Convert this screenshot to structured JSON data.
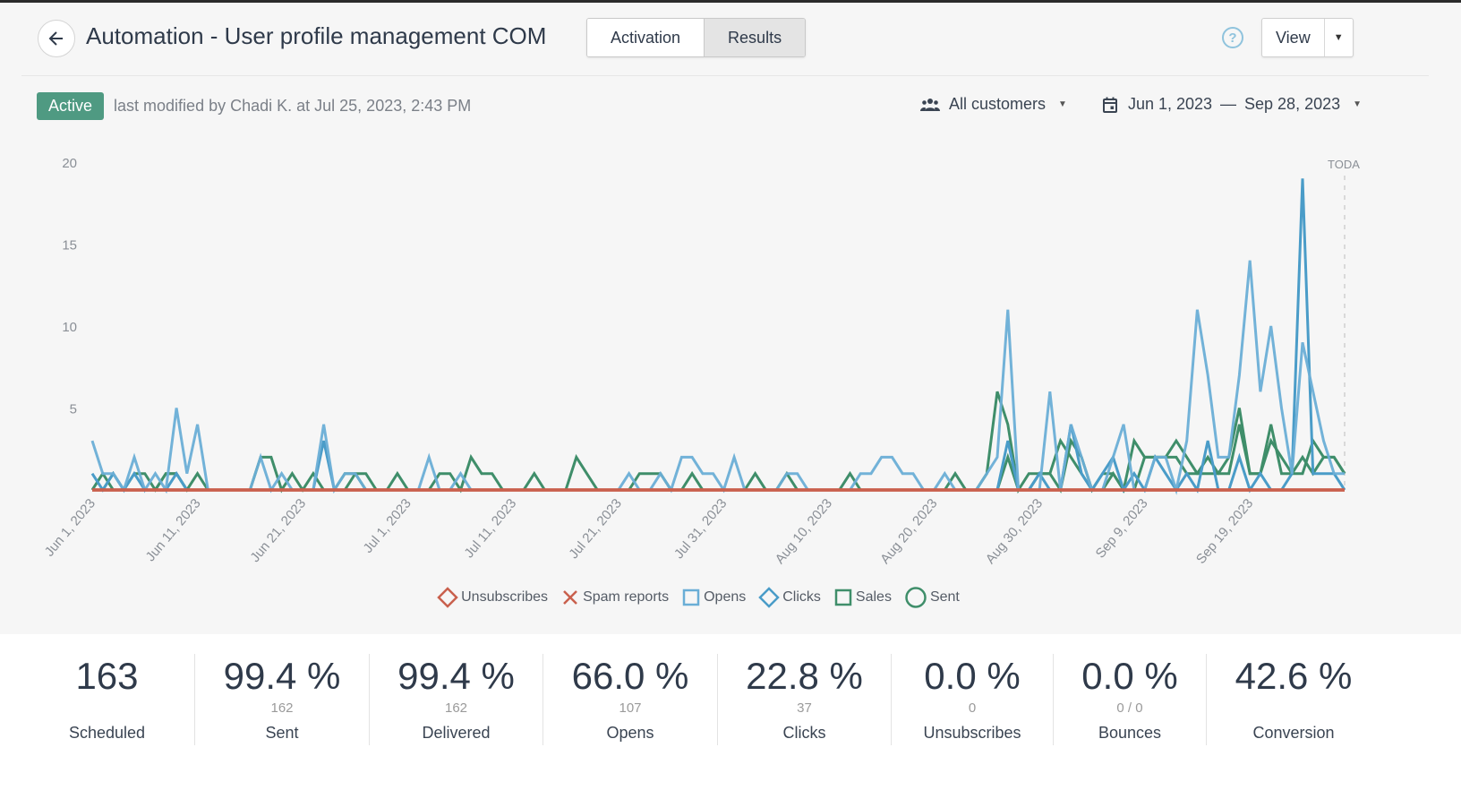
{
  "header": {
    "title": "Automation - User profile management COM",
    "tabs": [
      {
        "label": "Activation",
        "active": false
      },
      {
        "label": "Results",
        "active": true
      }
    ],
    "help_icon": "question-circle-icon",
    "view_label": "View"
  },
  "status": {
    "badge": "Active",
    "badge_color": "#4f9a82",
    "modified_text": "last modified by Chadi K. at Jul 25, 2023, 2:43 PM"
  },
  "filters": {
    "audience": "All customers",
    "date_start": "Jun 1, 2023",
    "date_sep": "—",
    "date_end": "Sep 28, 2023"
  },
  "chart_data": {
    "type": "line",
    "title": "",
    "xlabel": "",
    "ylabel": "",
    "ylim": [
      0,
      20
    ],
    "yticks": [
      "5",
      "10",
      "15",
      "20"
    ],
    "x_start": "Jun 1, 2023",
    "x_end": "Sep 28, 2023",
    "x_days": 120,
    "xtick_labels": [
      "Jun 1, 2023",
      "Jun 11, 2023",
      "Jun 21, 2023",
      "Jul 1, 2023",
      "Jul 11, 2023",
      "Jul 21, 2023",
      "Jul 31, 2023",
      "Aug 10, 2023",
      "Aug 20, 2023",
      "Aug 30, 2023",
      "Sep 9, 2023",
      "Sep 19, 2023"
    ],
    "today_label": "TODA",
    "grid": false,
    "legend_position": "bottom",
    "series": [
      {
        "name": "Unsubscribes",
        "color": "#c9604d",
        "marker": "diamond",
        "values": [
          0,
          0,
          0,
          0,
          0,
          0,
          0,
          0,
          0,
          0,
          0,
          0,
          0,
          0,
          0,
          0,
          0,
          0,
          0,
          0,
          0,
          0,
          0,
          0,
          0,
          0,
          0,
          0,
          0,
          0,
          0,
          0,
          0,
          0,
          0,
          0,
          0,
          0,
          0,
          0,
          0,
          0,
          0,
          0,
          0,
          0,
          0,
          0,
          0,
          0,
          0,
          0,
          0,
          0,
          0,
          0,
          0,
          0,
          0,
          0,
          0,
          0,
          0,
          0,
          0,
          0,
          0,
          0,
          0,
          0,
          0,
          0,
          0,
          0,
          0,
          0,
          0,
          0,
          0,
          0,
          0,
          0,
          0,
          0,
          0,
          0,
          0,
          0,
          0,
          0,
          0,
          0,
          0,
          0,
          0,
          0,
          0,
          0,
          0,
          0,
          0,
          0,
          0,
          0,
          0,
          0,
          0,
          0,
          0,
          0,
          0,
          0,
          0,
          0,
          0,
          0,
          0,
          0,
          0,
          0
        ]
      },
      {
        "name": "Spam reports",
        "color": "#c9604d",
        "marker": "x",
        "values": [
          0,
          0,
          0,
          0,
          0,
          0,
          0,
          0,
          0,
          0,
          0,
          0,
          0,
          0,
          0,
          0,
          0,
          0,
          0,
          0,
          0,
          0,
          0,
          0,
          0,
          0,
          0,
          0,
          0,
          0,
          0,
          0,
          0,
          0,
          0,
          0,
          0,
          0,
          0,
          0,
          0,
          0,
          0,
          0,
          0,
          0,
          0,
          0,
          0,
          0,
          0,
          0,
          0,
          0,
          0,
          0,
          0,
          0,
          0,
          0,
          0,
          0,
          0,
          0,
          0,
          0,
          0,
          0,
          0,
          0,
          0,
          0,
          0,
          0,
          0,
          0,
          0,
          0,
          0,
          0,
          0,
          0,
          0,
          0,
          0,
          0,
          0,
          0,
          0,
          0,
          0,
          0,
          0,
          0,
          0,
          0,
          0,
          0,
          0,
          0,
          0,
          0,
          0,
          0,
          0,
          0,
          0,
          0,
          0,
          0,
          0,
          0,
          0,
          0,
          0,
          0,
          0,
          0,
          0,
          0
        ]
      },
      {
        "name": "Opens",
        "color": "#6aaed6",
        "marker": "square",
        "values": [
          3,
          1,
          1,
          0,
          2,
          0,
          1,
          0,
          5,
          1,
          4,
          0,
          0,
          0,
          0,
          0,
          2,
          0,
          1,
          0,
          0,
          0,
          4,
          0,
          1,
          1,
          0,
          0,
          0,
          0,
          0,
          0,
          2,
          0,
          0,
          1,
          0,
          0,
          0,
          0,
          0,
          0,
          0,
          0,
          0,
          0,
          0,
          0,
          0,
          0,
          0,
          1,
          0,
          0,
          1,
          0,
          2,
          2,
          1,
          1,
          0,
          2,
          0,
          0,
          0,
          0,
          1,
          1,
          0,
          0,
          0,
          0,
          0,
          1,
          1,
          2,
          2,
          1,
          1,
          0,
          0,
          1,
          0,
          0,
          0,
          1,
          2,
          11,
          0,
          0,
          0,
          6,
          0,
          4,
          2,
          0,
          0,
          2,
          4,
          0,
          0,
          2,
          2,
          0,
          3,
          11,
          7,
          2,
          2,
          7,
          14,
          6,
          10,
          5,
          1,
          9,
          6,
          3,
          1,
          1
        ]
      },
      {
        "name": "Clicks",
        "color": "#4a9cc8",
        "marker": "diamond",
        "values": [
          1,
          0,
          1,
          0,
          1,
          0,
          0,
          0,
          1,
          0,
          0,
          0,
          0,
          0,
          0,
          0,
          0,
          0,
          0,
          0,
          0,
          0,
          3,
          0,
          0,
          0,
          0,
          0,
          0,
          0,
          0,
          0,
          0,
          0,
          0,
          0,
          0,
          0,
          0,
          0,
          0,
          0,
          0,
          0,
          0,
          0,
          0,
          0,
          0,
          0,
          0,
          0,
          0,
          0,
          0,
          0,
          0,
          0,
          0,
          0,
          0,
          0,
          0,
          0,
          0,
          0,
          0,
          0,
          0,
          0,
          0,
          0,
          0,
          0,
          0,
          0,
          0,
          0,
          0,
          0,
          0,
          0,
          0,
          0,
          0,
          0,
          0,
          3,
          0,
          0,
          1,
          0,
          0,
          4,
          1,
          0,
          1,
          2,
          0,
          1,
          0,
          2,
          1,
          0,
          1,
          0,
          3,
          0,
          0,
          2,
          0,
          1,
          0,
          0,
          1,
          19,
          1,
          1,
          1,
          0
        ]
      },
      {
        "name": "Sales",
        "color": "#3f8e6a",
        "marker": "square",
        "values": [
          0,
          1,
          0,
          0,
          1,
          1,
          0,
          1,
          1,
          0,
          1,
          0,
          0,
          0,
          0,
          0,
          2,
          2,
          0,
          1,
          0,
          1,
          0,
          0,
          0,
          1,
          1,
          0,
          0,
          1,
          0,
          0,
          0,
          1,
          1,
          0,
          2,
          1,
          1,
          0,
          0,
          0,
          1,
          0,
          0,
          0,
          2,
          1,
          0,
          0,
          0,
          0,
          1,
          1,
          1,
          0,
          0,
          1,
          0,
          0,
          0,
          0,
          0,
          1,
          0,
          0,
          1,
          0,
          0,
          0,
          0,
          0,
          1,
          0,
          0,
          0,
          0,
          0,
          0,
          0,
          0,
          0,
          1,
          0,
          0,
          1,
          6,
          4,
          0,
          1,
          1,
          1,
          0,
          3,
          2,
          0,
          1,
          1,
          0,
          3,
          2,
          2,
          2,
          3,
          2,
          1,
          1,
          1,
          2,
          5,
          1,
          1,
          3,
          2,
          1,
          1,
          3,
          2,
          2,
          1
        ]
      },
      {
        "name": "Sent",
        "color": "#3f8e6a",
        "marker": "circle",
        "values": [
          0,
          0,
          1,
          0,
          0,
          0,
          0,
          1,
          1,
          0,
          0,
          0,
          0,
          0,
          0,
          0,
          0,
          0,
          0,
          0,
          0,
          0,
          0,
          0,
          1,
          1,
          0,
          0,
          0,
          0,
          0,
          0,
          0,
          0,
          0,
          0,
          0,
          0,
          0,
          0,
          0,
          0,
          0,
          0,
          0,
          0,
          0,
          0,
          0,
          0,
          0,
          0,
          0,
          0,
          0,
          0,
          0,
          0,
          0,
          0,
          0,
          0,
          0,
          0,
          0,
          0,
          0,
          0,
          0,
          0,
          0,
          0,
          0,
          0,
          0,
          0,
          0,
          0,
          0,
          0,
          0,
          0,
          0,
          0,
          0,
          0,
          0,
          2,
          0,
          0,
          1,
          1,
          3,
          2,
          1,
          0,
          0,
          1,
          0,
          0,
          2,
          2,
          2,
          2,
          1,
          1,
          2,
          1,
          1,
          4,
          1,
          1,
          4,
          1,
          1,
          2,
          1,
          2,
          2,
          1
        ]
      }
    ]
  },
  "stats": [
    {
      "value": "163",
      "sub": "",
      "label": "Scheduled"
    },
    {
      "value": "99.4 %",
      "sub": "162",
      "label": "Sent"
    },
    {
      "value": "99.4 %",
      "sub": "162",
      "label": "Delivered"
    },
    {
      "value": "66.0 %",
      "sub": "107",
      "label": "Opens"
    },
    {
      "value": "22.8 %",
      "sub": "37",
      "label": "Clicks"
    },
    {
      "value": "0.0 %",
      "sub": "0",
      "label": "Unsubscribes"
    },
    {
      "value": "0.0 %",
      "sub": "0 / 0",
      "label": "Bounces"
    },
    {
      "value": "42.6 %",
      "sub": "",
      "label": "Conversion"
    }
  ]
}
